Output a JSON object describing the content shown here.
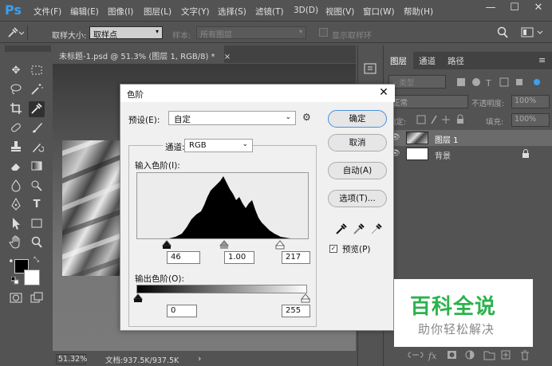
{
  "app": {
    "logo": "Ps"
  },
  "menu": [
    "文件(F)",
    "编辑(E)",
    "图像(I)",
    "图层(L)",
    "文字(Y)",
    "选择(S)",
    "滤镜(T)",
    "3D(D)",
    "视图(V)",
    "窗口(W)",
    "帮助(H)"
  ],
  "window_controls": {
    "minimize": "—",
    "maximize": "☐",
    "close": "✕"
  },
  "options": {
    "sample_size_label": "取样大小:",
    "sample_size_value": "取样点",
    "sample_label": "样本:",
    "sample_value": "所有图层",
    "show_ring_label": "显示取样环"
  },
  "document": {
    "tab_title": "未标题-1.psd @ 51.3% (图层 1, RGB/8) *",
    "tab_close": "×",
    "zoom": "51.32%",
    "doc_info": "文档:937.5K/937.5K",
    "status_arrow": "›"
  },
  "layers_panel": {
    "tabs": [
      "图层",
      "通道",
      "路径"
    ],
    "kind_filter": "类型",
    "blend_mode": "正常",
    "opacity_label": "不透明度:",
    "opacity_value": "100%",
    "lock_label": "锁定:",
    "fill_label": "填充:",
    "fill_value": "100%",
    "layers": [
      {
        "name": "图层 1",
        "selected": true,
        "visible": true
      },
      {
        "name": "背景",
        "selected": false,
        "visible": true,
        "locked": true
      }
    ]
  },
  "dialog": {
    "title": "色阶",
    "close": "✕",
    "preset_label": "预设(E):",
    "preset_value": "自定",
    "channel_label": "通道:",
    "channel_value": "RGB",
    "input_levels_label": "输入色阶(I):",
    "input_black": "46",
    "input_gamma": "1.00",
    "input_white": "217",
    "output_levels_label": "输出色阶(O):",
    "output_black": "0",
    "output_white": "255",
    "btn_ok": "确定",
    "btn_cancel": "取消",
    "btn_auto": "自动(A)",
    "btn_options": "选项(T)...",
    "preview_label": "预览(P)",
    "preview_checked": true
  },
  "watermark": {
    "line1": "百科全说",
    "line2": "助你轻松解决"
  },
  "colors": {
    "accent": "#3ba0f0",
    "watermark_green": "#2bb24c",
    "panel_bg": "#535353"
  }
}
